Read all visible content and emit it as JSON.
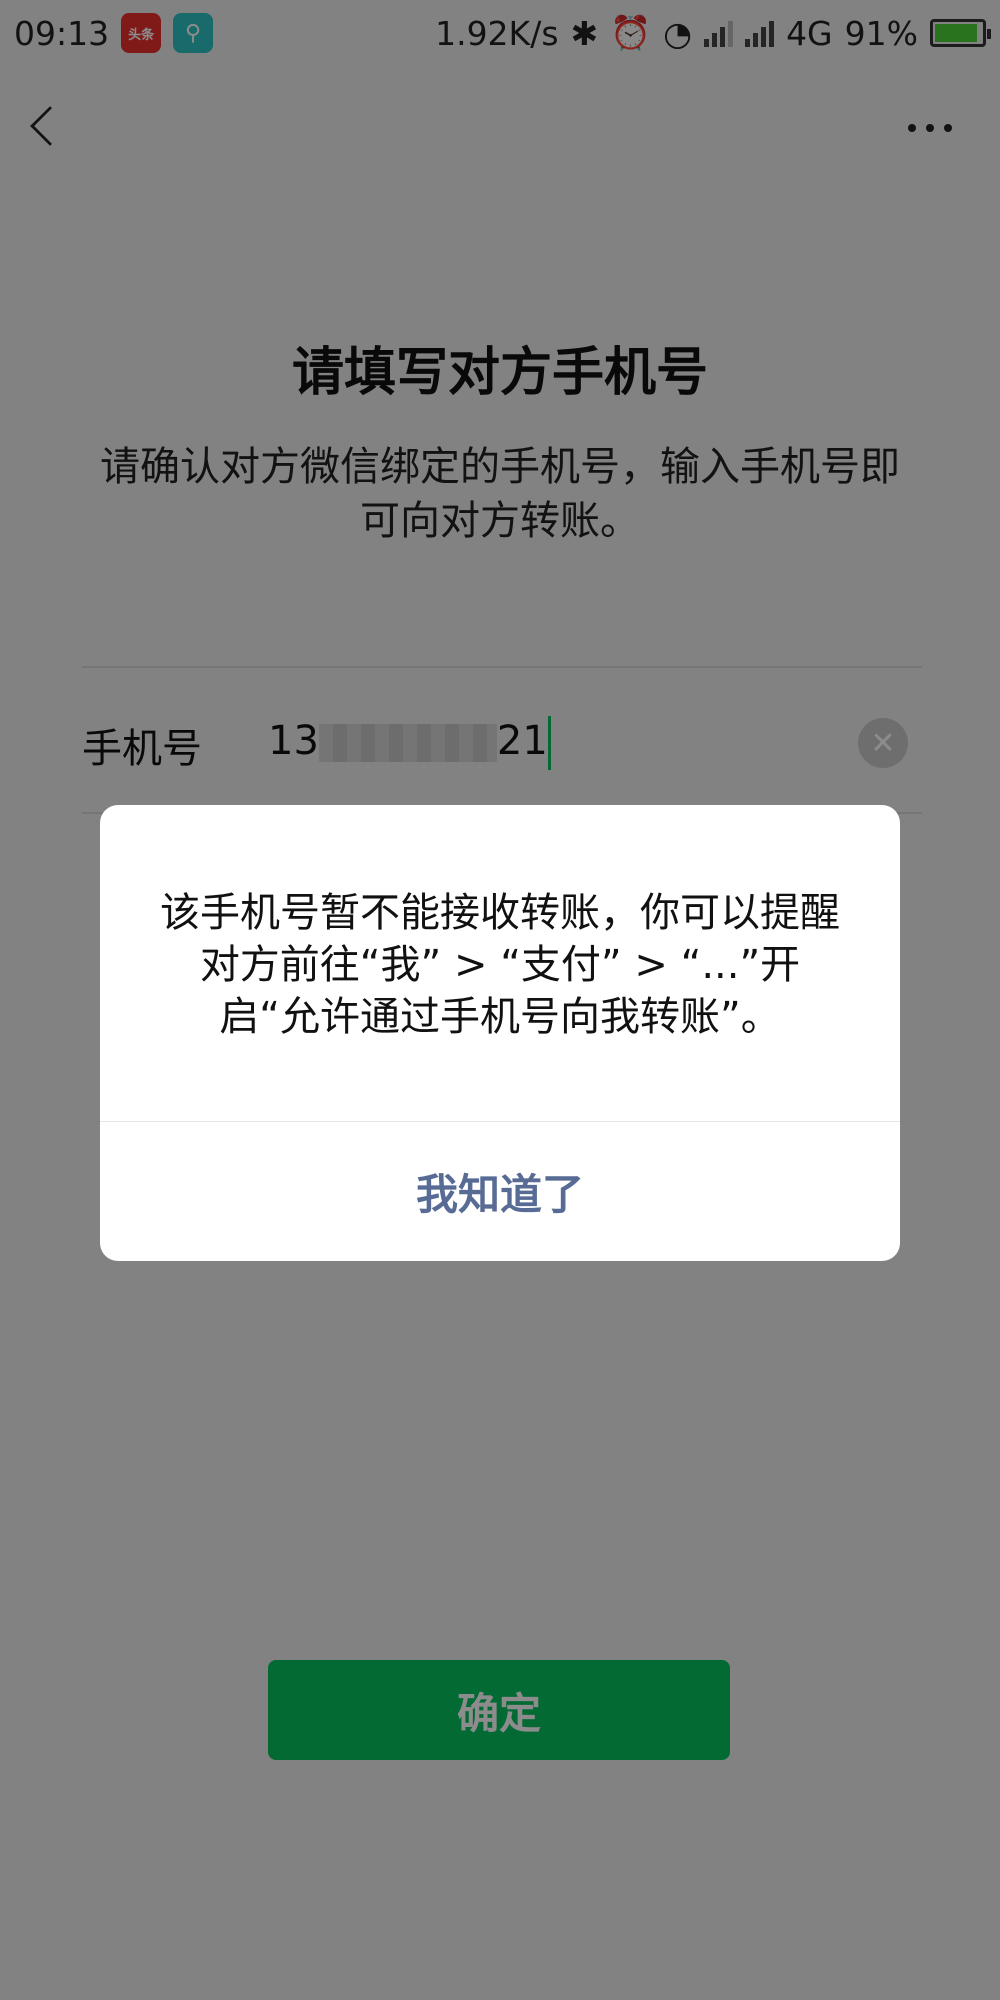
{
  "status_bar": {
    "time": "09:13",
    "news_badge": "头条",
    "usb_icon": "usb-icon",
    "net_speed": "1.92K/s",
    "network_type": "4G",
    "battery_percent": "91%",
    "battery_level": 0.91
  },
  "nav": {
    "back_icon": "chevron-left-icon",
    "more_icon": "more-dots-icon"
  },
  "page": {
    "title": "请填写对方手机号",
    "description": "请确认对方微信绑定的手机号，输入手机号即可向对方转账。"
  },
  "form": {
    "phone_label": "手机号",
    "phone_prefix": "13",
    "phone_suffix": "21",
    "clear_icon": "close-circle-icon"
  },
  "confirm_button": {
    "label": "确定"
  },
  "dialog": {
    "message": "该手机号暂不能接收转账，你可以提醒对方前往“我” > “支付” > “...”开启“允许通过手机号向我转账”。",
    "button_label": "我知道了"
  },
  "colors": {
    "accent": "#07c160",
    "dialog_button": "#576b95",
    "background": "#ededed"
  }
}
